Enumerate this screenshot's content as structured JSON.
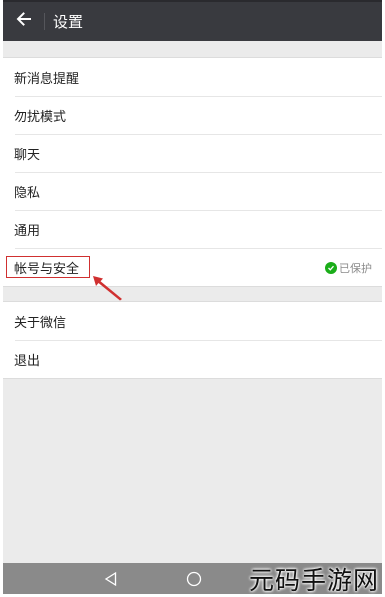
{
  "header": {
    "title": "设置",
    "back_icon": "arrow-left-icon"
  },
  "settings": {
    "group1": [
      {
        "label": "新消息提醒"
      },
      {
        "label": "勿扰模式"
      },
      {
        "label": "聊天"
      },
      {
        "label": "隐私"
      },
      {
        "label": "通用"
      },
      {
        "label": "帐号与安全",
        "status": "已保护",
        "status_icon": "shield-check-icon",
        "highlighted": true
      }
    ],
    "group2": [
      {
        "label": "关于微信"
      },
      {
        "label": "退出"
      }
    ]
  },
  "annotation": {
    "color": "#d03030"
  },
  "navbar": {
    "back_icon": "triangle-back-icon",
    "home_icon": "circle-home-icon"
  },
  "watermark": {
    "text": "元码手游网"
  },
  "colors": {
    "topbar": "#393a3f",
    "background": "#ebebeb",
    "accent_green": "#1aad19"
  }
}
